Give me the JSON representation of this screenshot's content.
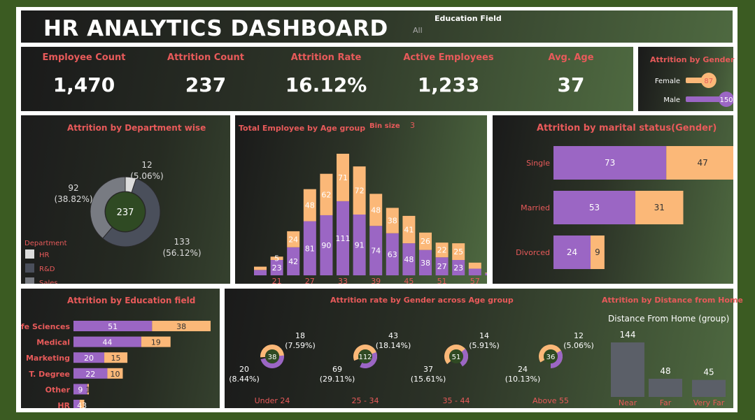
{
  "header": {
    "title": "HR ANALYTICS DASHBOARD",
    "filter_label": "Education Field",
    "filter_value": "All"
  },
  "kpis": [
    {
      "label": "Employee Count",
      "value": "1,470"
    },
    {
      "label": "Attrition Count",
      "value": "237"
    },
    {
      "label": "Attrition Rate",
      "value": "16.12%"
    },
    {
      "label": "Active Employees",
      "value": "1,233"
    },
    {
      "label": "Avg. Age",
      "value": "37"
    }
  ],
  "colors": {
    "purple": "#9b66c4",
    "orange": "#fbb878",
    "green_fill": "#2f4a23",
    "slate": "#5b5f68"
  },
  "chart_data": [
    {
      "type": "bar",
      "orientation": "horizontal",
      "title": "Attrition by Gender",
      "categories": [
        "Female",
        "Male"
      ],
      "values": [
        87,
        150
      ]
    },
    {
      "type": "pie",
      "style": "donut",
      "title": "Attrition by Department wise",
      "center_value": "237",
      "legend_title": "Department",
      "slices": [
        {
          "name": "HR",
          "value": 12,
          "label": "12",
          "pct": "(5.06%)",
          "color": "#dcdcdc"
        },
        {
          "name": "R&D",
          "value": 133,
          "label": "133",
          "pct": "(56.12%)",
          "color": "#4a4f5b"
        },
        {
          "name": "Sales",
          "value": 92,
          "label": "92",
          "pct": "(38.82%)",
          "color": "#787b82"
        }
      ]
    },
    {
      "type": "bar",
      "stacked": true,
      "title": "Total Employee by Age group",
      "bin_label": "Bin size",
      "bin_value": "3",
      "x_ticks": [
        "21",
        "27",
        "33",
        "39",
        "45",
        "51",
        "57"
      ],
      "bins": [
        18,
        21,
        24,
        27,
        30,
        33,
        36,
        39,
        42,
        45,
        48,
        51,
        54,
        57,
        60
      ],
      "series": [
        {
          "values": [
            8,
            23,
            42,
            81,
            90,
            111,
            91,
            74,
            63,
            48,
            38,
            27,
            23,
            10,
            3
          ]
        },
        {
          "values": [
            5,
            5,
            24,
            48,
            62,
            71,
            72,
            48,
            38,
            41,
            26,
            22,
            25,
            9,
            1
          ]
        }
      ],
      "show_labels": [
        false,
        true,
        true,
        true,
        true,
        true,
        true,
        true,
        true,
        true,
        true,
        true,
        true,
        false,
        false
      ]
    },
    {
      "type": "bar",
      "orientation": "horizontal",
      "stacked": true,
      "title": "Attrition by marital status(Gender)",
      "categories": [
        "Single",
        "Married",
        "Divorced"
      ],
      "series": [
        {
          "values": [
            73,
            53,
            24
          ]
        },
        {
          "values": [
            47,
            31,
            9
          ]
        }
      ]
    },
    {
      "type": "bar",
      "orientation": "horizontal",
      "stacked": true,
      "title": "Attrition by Education field",
      "categories": [
        "Life Sciences",
        "Medical",
        "Marketing",
        "T. Degree",
        "Other",
        "HR"
      ],
      "series": [
        {
          "values": [
            51,
            44,
            20,
            22,
            9,
            4
          ]
        },
        {
          "values": [
            38,
            19,
            15,
            10,
            1,
            3
          ]
        }
      ],
      "hr_label": "43"
    },
    {
      "type": "pie",
      "style": "donut",
      "title": "Attrition rate by Gender across Age group",
      "groups": [
        {
          "name": "Under 24",
          "total": "38",
          "left": {
            "value": 20,
            "pct": "(8.44%)"
          },
          "right": {
            "value": 18,
            "pct": "(7.59%)"
          }
        },
        {
          "name": "25 - 34",
          "total": "112",
          "left": {
            "value": 69,
            "pct": "(29.11%)"
          },
          "right": {
            "value": 43,
            "pct": "(18.14%)"
          }
        },
        {
          "name": "35 - 44",
          "total": "51",
          "left": {
            "value": 37,
            "pct": "(15.61%)"
          },
          "right": {
            "value": 14,
            "pct": "(5.91%)"
          }
        },
        {
          "name": "Above 55",
          "total": "36",
          "left": {
            "value": 24,
            "pct": "(10.13%)"
          },
          "right": {
            "value": 12,
            "pct": "(5.06%)"
          }
        }
      ]
    },
    {
      "type": "bar",
      "title": "Attrition by Distance from Home",
      "subtitle": "Distance From Home (group)",
      "categories": [
        "Near",
        "Far",
        "Very Far"
      ],
      "values": [
        144,
        48,
        45
      ]
    }
  ]
}
